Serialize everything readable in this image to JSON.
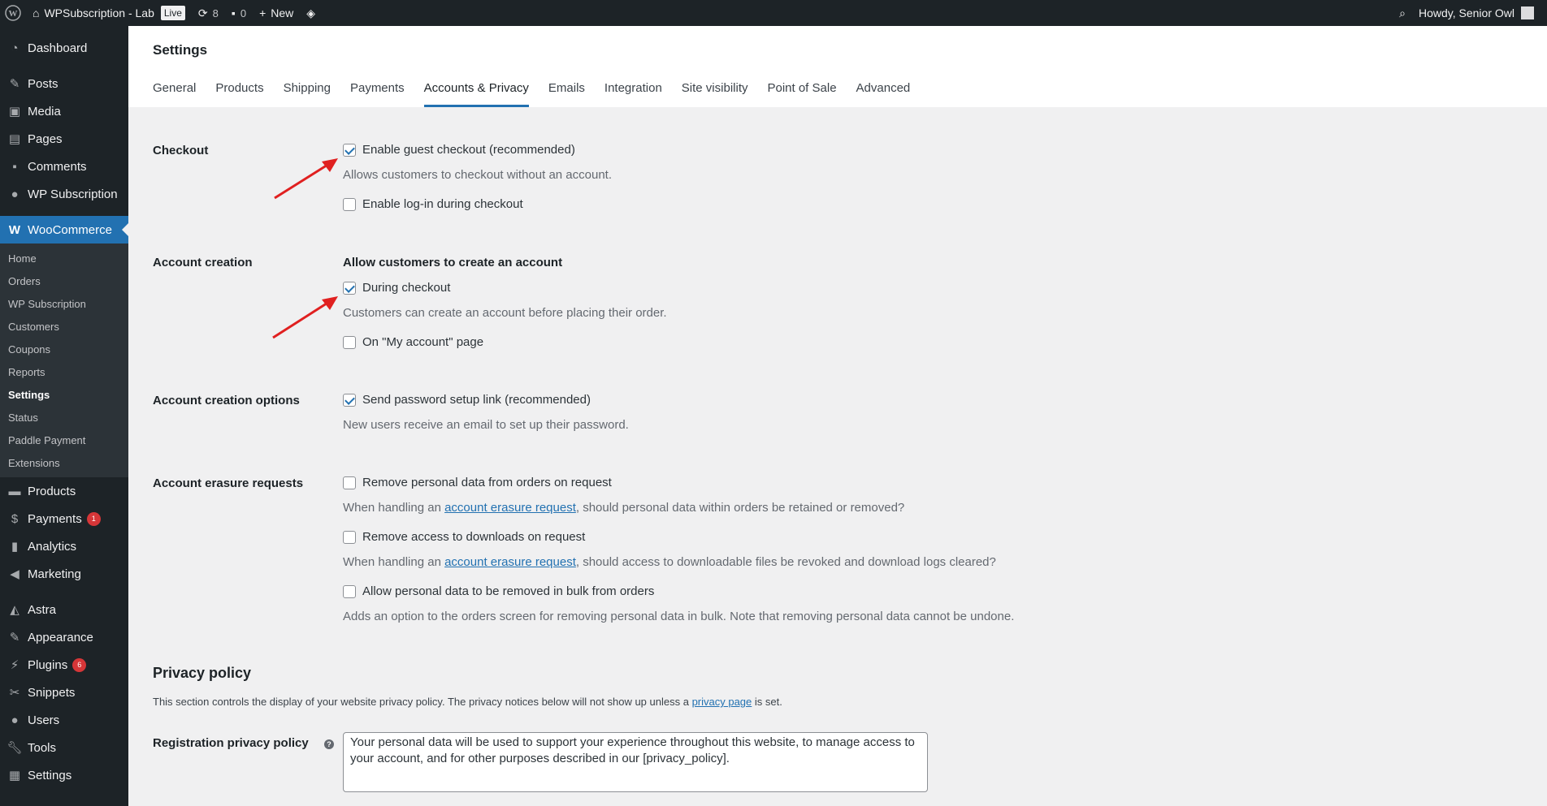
{
  "adminbar": {
    "site_name": "WPSubscription - Lab",
    "live_badge": "Live",
    "updates_count": "8",
    "comments_count": "0",
    "new_label": "New",
    "howdy": "Howdy, Senior Owl"
  },
  "sidebar": {
    "items_top": [
      {
        "label": "Dashboard",
        "icon": "dashboard-icon"
      },
      {
        "label": "Posts",
        "icon": "pin-icon"
      },
      {
        "label": "Media",
        "icon": "media-icon"
      },
      {
        "label": "Pages",
        "icon": "pages-icon"
      },
      {
        "label": "Comments",
        "icon": "comment-icon"
      },
      {
        "label": "WP Subscription",
        "icon": "subscription-icon"
      }
    ],
    "woocommerce": {
      "label": "WooCommerce",
      "icon": "woo-icon"
    },
    "submenu": [
      "Home",
      "Orders",
      "WP Subscription",
      "Customers",
      "Coupons",
      "Reports",
      "Settings",
      "Status",
      "Paddle Payment",
      "Extensions"
    ],
    "items_bottom": [
      {
        "label": "Products",
        "icon": "products-icon",
        "badge": ""
      },
      {
        "label": "Payments",
        "icon": "payments-icon",
        "badge": "1"
      },
      {
        "label": "Analytics",
        "icon": "analytics-icon",
        "badge": ""
      },
      {
        "label": "Marketing",
        "icon": "marketing-icon",
        "badge": ""
      },
      {
        "label": "Astra",
        "icon": "astra-icon",
        "badge": ""
      },
      {
        "label": "Appearance",
        "icon": "appearance-icon",
        "badge": ""
      },
      {
        "label": "Plugins",
        "icon": "plugins-icon",
        "badge": "6"
      },
      {
        "label": "Snippets",
        "icon": "snippets-icon",
        "badge": ""
      },
      {
        "label": "Users",
        "icon": "users-icon",
        "badge": ""
      },
      {
        "label": "Tools",
        "icon": "tools-icon",
        "badge": ""
      },
      {
        "label": "Settings",
        "icon": "settings-icon",
        "badge": ""
      }
    ]
  },
  "page": {
    "title": "Settings",
    "tabs": [
      "General",
      "Products",
      "Shipping",
      "Payments",
      "Accounts & Privacy",
      "Emails",
      "Integration",
      "Site visibility",
      "Point of Sale",
      "Advanced"
    ],
    "active_tab": "Accounts & Privacy"
  },
  "checkout": {
    "label": "Checkout",
    "guest_checkout": {
      "label": "Enable guest checkout (recommended)",
      "checked": true
    },
    "guest_desc": "Allows customers to checkout without an account.",
    "login_checkout": {
      "label": "Enable log-in during checkout",
      "checked": false
    }
  },
  "account_creation": {
    "label": "Account creation",
    "legend": "Allow customers to create an account",
    "during_checkout": {
      "label": "During checkout",
      "checked": true
    },
    "during_desc": "Customers can create an account before placing their order.",
    "my_account": {
      "label": "On \"My account\" page",
      "checked": false
    }
  },
  "account_options": {
    "label": "Account creation options",
    "send_password": {
      "label": "Send password setup link (recommended)",
      "checked": true
    },
    "send_desc": "New users receive an email to set up their password."
  },
  "erasure": {
    "label": "Account erasure requests",
    "remove_orders": {
      "label": "Remove personal data from orders on request",
      "checked": false
    },
    "remove_orders_desc_pre": "When handling an ",
    "remove_orders_link": "account erasure request",
    "remove_orders_desc_post": ", should personal data within orders be retained or removed?",
    "remove_downloads": {
      "label": "Remove access to downloads on request",
      "checked": false
    },
    "remove_downloads_desc_pre": "When handling an ",
    "remove_downloads_link": "account erasure request",
    "remove_downloads_desc_post": ", should access to downloadable files be revoked and download logs cleared?",
    "bulk": {
      "label": "Allow personal data to be removed in bulk from orders",
      "checked": false
    },
    "bulk_desc": "Adds an option to the orders screen for removing personal data in bulk. Note that removing personal data cannot be undone."
  },
  "privacy": {
    "title": "Privacy policy",
    "desc_pre": "This section controls the display of your website privacy policy. The privacy notices below will not show up unless a ",
    "desc_link": "privacy page",
    "desc_post": " is set.",
    "registration_label": "Registration privacy policy",
    "registration_value": "Your personal data will be used to support your experience throughout this website, to manage access to your account, and for other purposes described in our [privacy_policy]."
  },
  "colors": {
    "accent": "#2271b1",
    "sidebar_bg": "#1d2327",
    "badge_red": "#d63638",
    "arrow_red": "#e02020"
  }
}
